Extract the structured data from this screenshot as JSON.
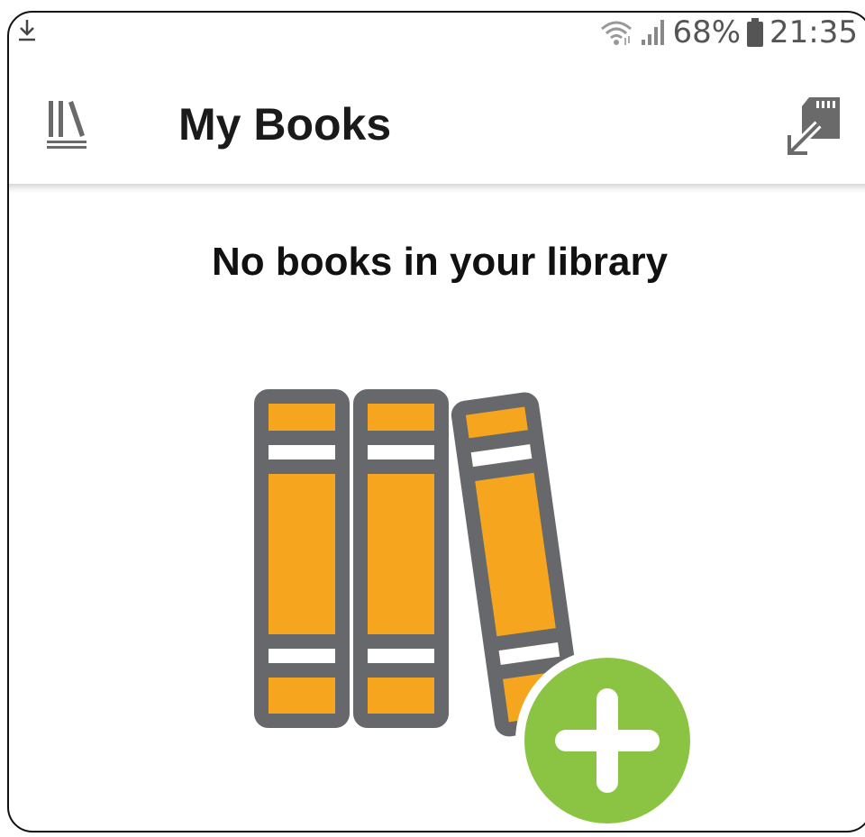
{
  "status_bar": {
    "battery_level": "68%",
    "time": "21:35",
    "icons": [
      "download-icon",
      "wifi-icon",
      "signal-icon",
      "battery-icon"
    ]
  },
  "toolbar": {
    "title": "My Books",
    "left_icon": "library-icon",
    "right_icon": "sd-card-transfer-icon"
  },
  "content": {
    "empty_message": "No books in your library",
    "illustration": "books-with-add-icon",
    "colors": {
      "book_orange": "#F6A61E",
      "book_outline": "#67686B",
      "add_green": "#8BC443"
    }
  }
}
